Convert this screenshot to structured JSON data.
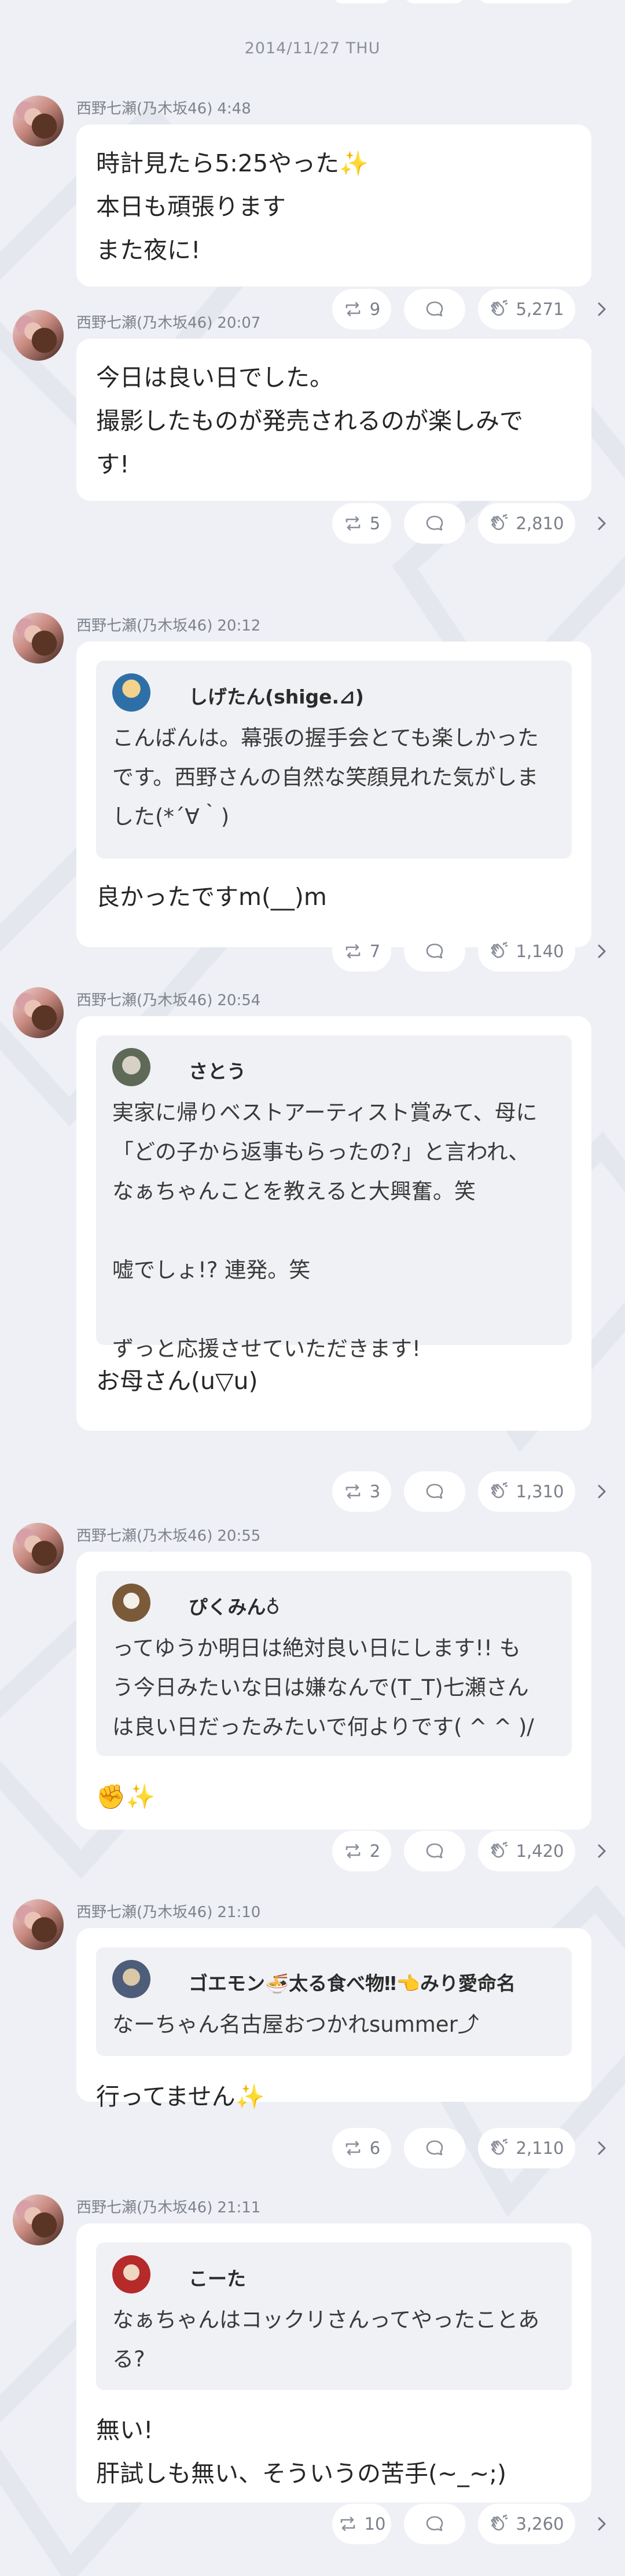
{
  "date_header": "2014/11/27 THU",
  "posts": [
    {
      "author": "西野七瀬(乃木坂46)",
      "time": "4:48",
      "text": [
        "時計見たら5:25やった",
        "本日も頑張ります",
        "また夜に!"
      ],
      "sparkle_after_line": 0,
      "stats": {
        "reposts": "9",
        "claps": "5,271"
      }
    },
    {
      "author": "西野七瀬(乃木坂46)",
      "time": "20:07",
      "text": [
        "今日は良い日でした。",
        "撮影したものが発売されるのが楽しみで",
        "す!"
      ],
      "stats": {
        "reposts": "5",
        "claps": "2,810"
      }
    },
    {
      "author": "西野七瀬(乃木坂46)",
      "time": "20:12",
      "quote": {
        "name": "しげたん(shige.⊿)",
        "text": [
          "こんばんは。幕張の握手会とても楽しかった",
          "です。西野さんの自然な笑顔見れた気がしま",
          "した(*´∀｀)"
        ]
      },
      "text": [
        "良かったですm(__)m"
      ],
      "stats": {
        "reposts": "7",
        "claps": "1,140"
      }
    },
    {
      "author": "西野七瀬(乃木坂46)",
      "time": "20:54",
      "quote": {
        "name": "さとう",
        "text": [
          "実家に帰りベストアーティスト賞みて、母に",
          "「どの子から返事もらったの?」と言われ、",
          "なぁちゃんことを教えると大興奮。笑",
          "",
          "嘘でしょ!? 連発。笑",
          "",
          "ずっと応援させていただきます!"
        ]
      },
      "text": [
        "お母さん(u▽u)"
      ],
      "stats": {
        "reposts": "3",
        "claps": "1,310"
      }
    },
    {
      "author": "西野七瀬(乃木坂46)",
      "time": "20:55",
      "quote": {
        "name": "ぴくみん♁",
        "text": [
          "ってゆうか明日は絶対良い日にします!! も",
          "う今日みたいな日は嫌なんで(T_T)七瀬さん",
          "は良い日だったみたいで何よりです( ^ ^ )/"
        ]
      },
      "text": [
        "✊✨"
      ],
      "stats": {
        "reposts": "2",
        "claps": "1,420"
      }
    },
    {
      "author": "西野七瀬(乃木坂46)",
      "time": "21:10",
      "quote": {
        "name": "ゴエモン🍜太る食べ物‼👈みり愛命名",
        "text": [
          "なーちゃん名古屋おつかれsummer⤴"
        ]
      },
      "text": [
        "行ってません"
      ],
      "sparkle_after_line": 0,
      "stats": {
        "reposts": "6",
        "claps": "2,110"
      }
    },
    {
      "author": "西野七瀬(乃木坂46)",
      "time": "21:11",
      "quote": {
        "name": "こーた",
        "text": [
          "なぁちゃんはコックリさんってやったことあ",
          "る?"
        ]
      },
      "text": [
        "無い!",
        "肝試しも無い、そういうの苦手(~_~;)"
      ],
      "stats": {
        "reposts": "10",
        "claps": "3,260"
      }
    }
  ],
  "colors": {
    "background": "#eef0f5",
    "card": "#ffffff",
    "quote_bg": "#f0f1f4",
    "meta_text": "#7d828c",
    "sparkle": "#f4c430"
  },
  "icons": {
    "repost": "repost-icon",
    "comment": "comment-icon",
    "clap": "clap-icon",
    "chevron": "chevron-right-icon"
  }
}
